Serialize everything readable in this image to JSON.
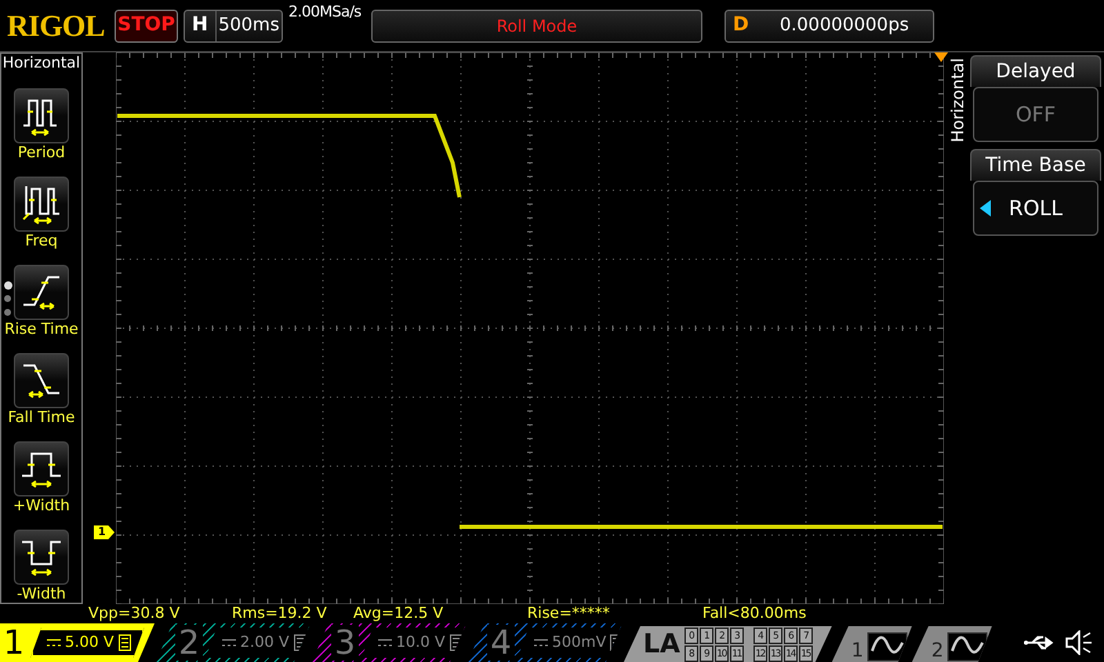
{
  "brand": "RIGOL",
  "run_state": "STOP",
  "timebase": {
    "key": "H",
    "value": "500ms"
  },
  "sample_rate": "2.00MSa/s",
  "mode": "Roll Mode",
  "delay": {
    "key": "D",
    "value": "0.00000000ps"
  },
  "sidebar": {
    "title": "Horizontal",
    "items": [
      {
        "label": "Period",
        "kind": "period"
      },
      {
        "label": "Freq",
        "kind": "freq"
      },
      {
        "label": "Rise Time",
        "kind": "rise"
      },
      {
        "label": "Fall Time",
        "kind": "fall"
      },
      {
        "label": "+Width",
        "kind": "pwidth"
      },
      {
        "label": "-Width",
        "kind": "nwidth"
      }
    ],
    "pages": [
      {
        "selected": true
      },
      {
        "selected": false
      },
      {
        "selected": false
      }
    ]
  },
  "channel_marker": "1",
  "right_menu": {
    "title": "Horizontal",
    "items": [
      {
        "title": "Delayed",
        "value": "OFF",
        "disabled": true,
        "selector": false
      },
      {
        "title": "Time Base",
        "value": "ROLL",
        "disabled": false,
        "selector": true
      }
    ]
  },
  "measurements": [
    "Vpp=30.8 V",
    "Rms=19.2 V",
    "Avg=12.5 V",
    "Rise=*****",
    "Fall<80.00ms"
  ],
  "channels": [
    {
      "number": "1",
      "scale": "5.00 V",
      "active": true,
      "color": "#ffff00"
    },
    {
      "number": "2",
      "scale": "2.00 V",
      "active": false,
      "color": "#00a08c"
    },
    {
      "number": "3",
      "scale": "10.0 V",
      "active": false,
      "color": "#c000c0"
    },
    {
      "number": "4",
      "scale": "500mV",
      "active": false,
      "color": "#1060c0"
    }
  ],
  "la": {
    "label": "LA",
    "digits": [
      "0",
      "1",
      "2",
      "3",
      "4",
      "5",
      "6",
      "7",
      "8",
      "9",
      "10",
      "11",
      "12",
      "13",
      "14",
      "15"
    ]
  },
  "generators": [
    "1",
    "2"
  ]
}
